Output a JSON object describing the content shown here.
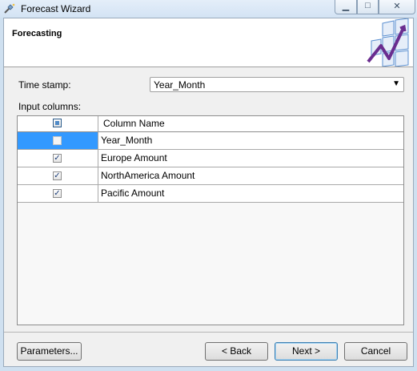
{
  "window": {
    "title": "Forecast Wizard"
  },
  "header": {
    "title": "Forecasting"
  },
  "form": {
    "timestamp_label": "Time stamp:",
    "timestamp_value": "Year_Month",
    "input_columns_label": "Input columns:"
  },
  "grid": {
    "column_header": "Column Name",
    "rows": [
      {
        "name": "Year_Month",
        "checked": false,
        "enabled": false
      },
      {
        "name": "Europe Amount",
        "checked": true,
        "enabled": true
      },
      {
        "name": "NorthAmerica Amount",
        "checked": true,
        "enabled": true
      },
      {
        "name": "Pacific Amount",
        "checked": true,
        "enabled": true
      }
    ]
  },
  "buttons": {
    "parameters": "Parameters...",
    "back": "< Back",
    "next": "Next >",
    "cancel": "Cancel"
  },
  "colors": {
    "selection": "#3399ff",
    "banner_bg": "#ffffff",
    "dialog_bg": "#f0f0f0"
  }
}
